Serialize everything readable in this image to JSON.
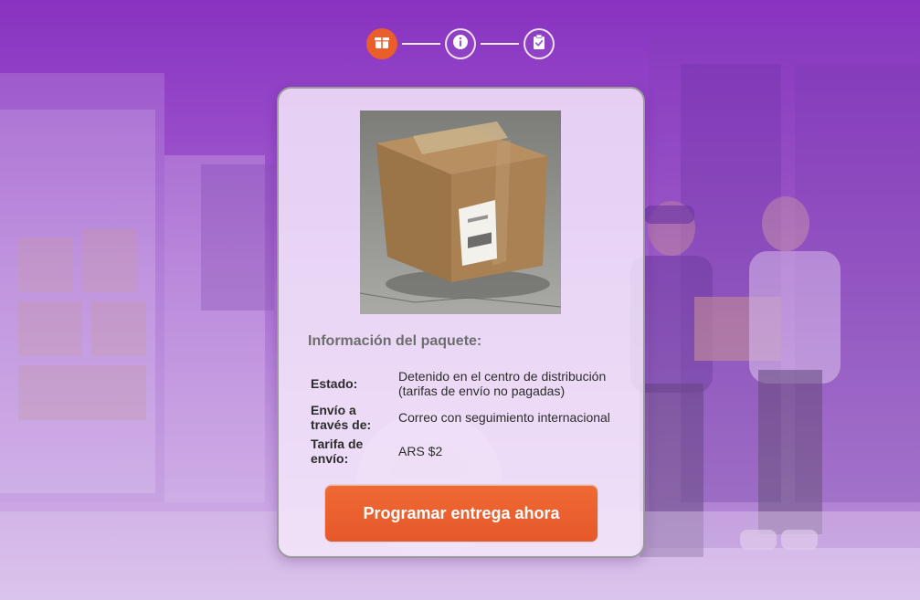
{
  "stepper": {
    "steps": [
      {
        "icon": "package-icon",
        "state": "active"
      },
      {
        "icon": "info-icon",
        "state": "inactive"
      },
      {
        "icon": "clipboard-check-icon",
        "state": "inactive"
      }
    ],
    "active_color": "#e95e2b"
  },
  "card": {
    "image_icon": "cardboard-box-image",
    "section_title": "Información del paquete:",
    "rows": [
      {
        "label": "Estado:",
        "value_line1": "Detenido en el centro de distribución",
        "value_line2": "(tarifas de envío no pagadas)"
      },
      {
        "label_line1": "Envío a",
        "label_line2": "través de:",
        "value": "Correo con seguimiento internacional"
      },
      {
        "label_line1": "Tarifa de",
        "label_line2": "envío:",
        "value": "ARS $2"
      }
    ],
    "cta_label": "Programar entrega ahora",
    "cta_color": "#e95e2b"
  }
}
